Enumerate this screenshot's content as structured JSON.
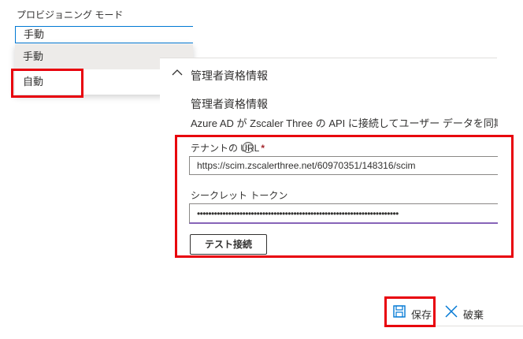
{
  "provisioning": {
    "mode_label": "プロビジョニング モード",
    "selected_value": "手動",
    "options": [
      "手動",
      "自動"
    ]
  },
  "admin_panel": {
    "header": "管理者資格情報",
    "section_title": "管理者資格情報",
    "description": "Azure AD が Zscaler Three の API に接続してユーザー データを同期するには",
    "tenant_url_label": "テナントの URL",
    "required_marker": "*",
    "info_icon": "ⓘ",
    "tenant_url_value": "https://scim.zscalerthree.net/60970351/148316/scim",
    "secret_token_label": "シークレット トークン",
    "secret_token_value": "•••••••••••••••••••••••••••••••••••••••••••••••••••••••••••••••••••••••",
    "test_button": "テスト接続"
  },
  "command_bar": {
    "save_label": "保存",
    "discard_label": "破棄"
  },
  "colors": {
    "highlight": "#e8000c",
    "accent": "#0078d4",
    "focus_underline": "#8764b8",
    "required": "#a4262c"
  },
  "icons": {
    "collapse": "chevron-up-icon",
    "info": "info-icon",
    "save": "save-icon",
    "discard": "close-icon"
  }
}
